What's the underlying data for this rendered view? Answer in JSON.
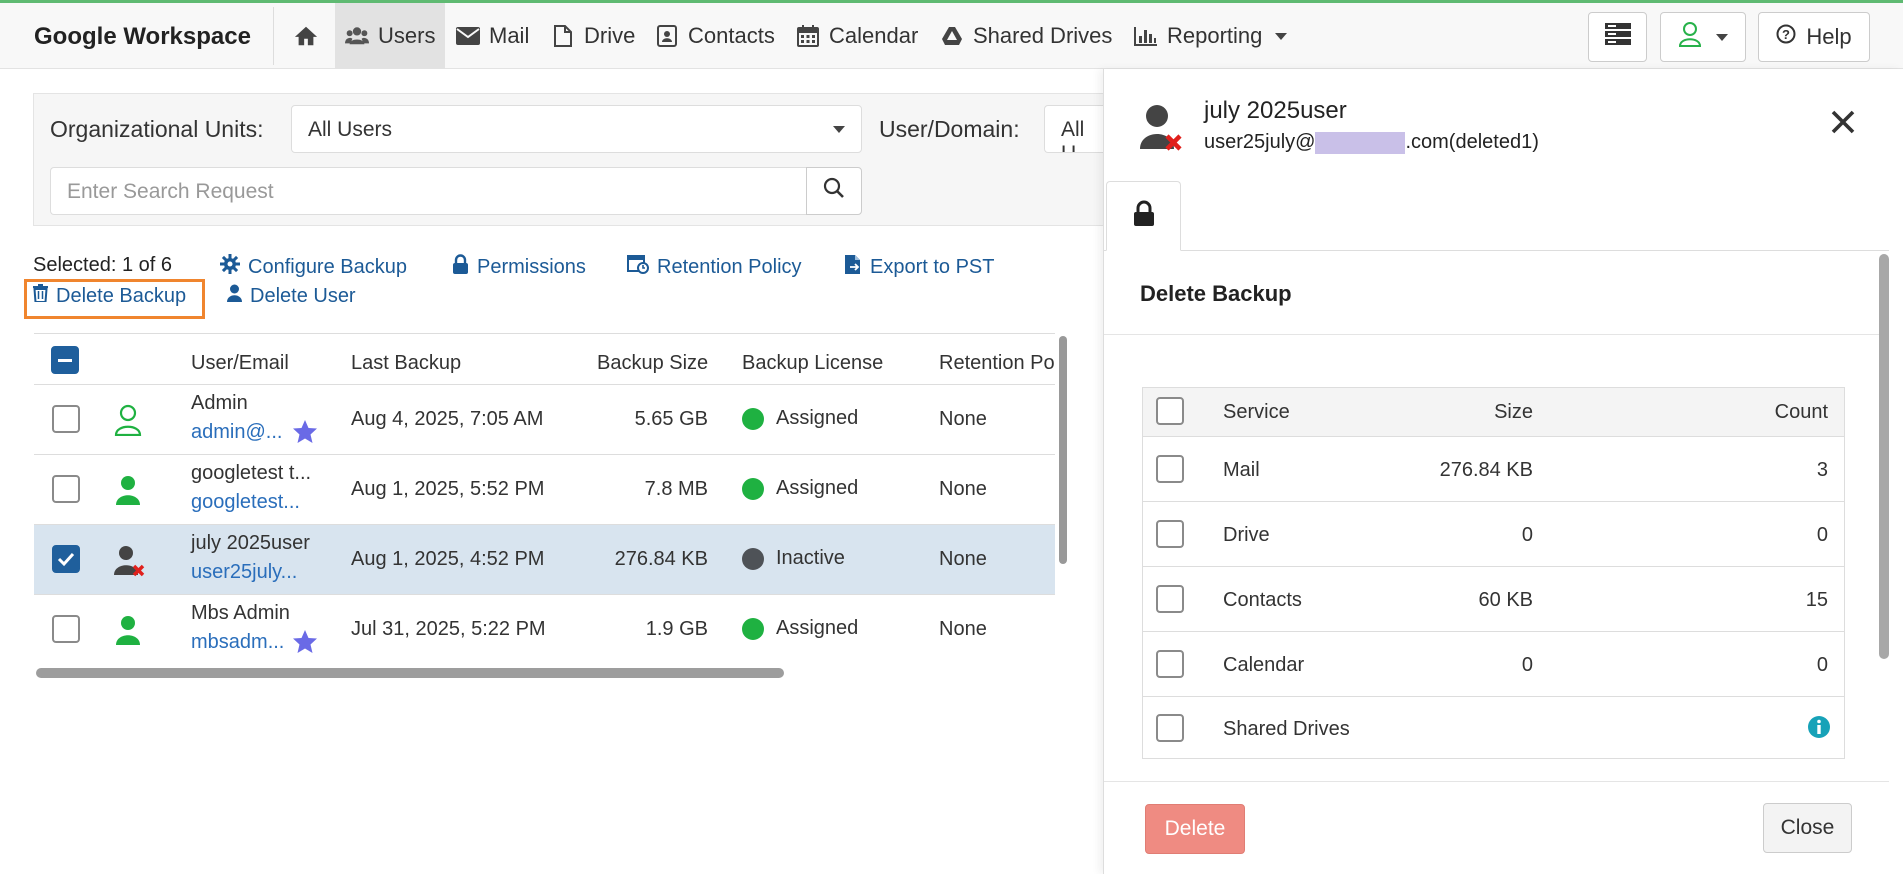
{
  "app": {
    "brand": "Google Workspace"
  },
  "nav": {
    "items": [
      {
        "label": "",
        "icon": "home-icon"
      },
      {
        "label": "Users",
        "icon": "users-icon",
        "active": true
      },
      {
        "label": "Mail",
        "icon": "envelope-icon"
      },
      {
        "label": "Drive",
        "icon": "file-icon"
      },
      {
        "label": "Contacts",
        "icon": "contact-card-icon"
      },
      {
        "label": "Calendar",
        "icon": "calendar-icon"
      },
      {
        "label": "Shared Drives",
        "icon": "shared-drive-icon"
      },
      {
        "label": "Reporting",
        "icon": "bar-chart-icon"
      }
    ],
    "help_label": "Help"
  },
  "filter": {
    "org_units_label": "Organizational Units:",
    "org_units_value": "All Users",
    "user_domain_label": "User/Domain:",
    "user_domain_value": "All U",
    "search_placeholder": "Enter Search Request"
  },
  "actions": {
    "selected_text": "Selected: 1 of 6",
    "configure_backup": "Configure Backup",
    "permissions": "Permissions",
    "retention_policy": "Retention Policy",
    "export_pst": "Export to PST",
    "delete_backup": "Delete Backup",
    "delete_user": "Delete User"
  },
  "table": {
    "columns": [
      "User/Email",
      "Last Backup",
      "Backup Size",
      "Backup License",
      "Retention Po"
    ],
    "rows": [
      {
        "name": "Admin",
        "email": "admin@...",
        "last_backup": "Aug 4, 2025, 7:05 AM",
        "size": "5.65 GB",
        "license": "Assigned",
        "retention": "None"
      },
      {
        "name": "googletest t...",
        "email": "googletest...",
        "last_backup": "Aug 1, 2025, 5:52 PM",
        "size": "7.8 MB",
        "license": "Assigned",
        "retention": "None"
      },
      {
        "name": "july 2025user",
        "email": "user25july...",
        "last_backup": "Aug 1, 2025, 4:52 PM",
        "size": "276.84 KB",
        "license": "Inactive",
        "retention": "None"
      },
      {
        "name": "Mbs Admin",
        "email": "mbsadm...",
        "last_backup": "Jul 31, 2025, 5:22 PM",
        "size": "1.9 GB",
        "license": "Assigned",
        "retention": "None"
      }
    ]
  },
  "panel": {
    "user_name": "july 2025user",
    "email_prefix": "user25july@",
    "email_suffix": ".com(deleted1)",
    "section_title": "Delete Backup",
    "columns": {
      "service": "Service",
      "size": "Size",
      "count": "Count"
    },
    "services": [
      {
        "service": "Mail",
        "size": "276.84 KB",
        "count": "3"
      },
      {
        "service": "Drive",
        "size": "0",
        "count": "0"
      },
      {
        "service": "Contacts",
        "size": "60 KB",
        "count": "15"
      },
      {
        "service": "Calendar",
        "size": "0",
        "count": "0"
      },
      {
        "service": "Shared Drives",
        "size": "",
        "count": ""
      }
    ],
    "delete_label": "Delete",
    "close_label": "Close"
  },
  "colors": {
    "accent_blue": "#1c5a96",
    "assigned_green": "#1fb141",
    "inactive_dark": "#4e5257",
    "highlight_orange": "#f0852e",
    "delete_button": "#ef8b82",
    "info_teal": "#17a2b8"
  }
}
